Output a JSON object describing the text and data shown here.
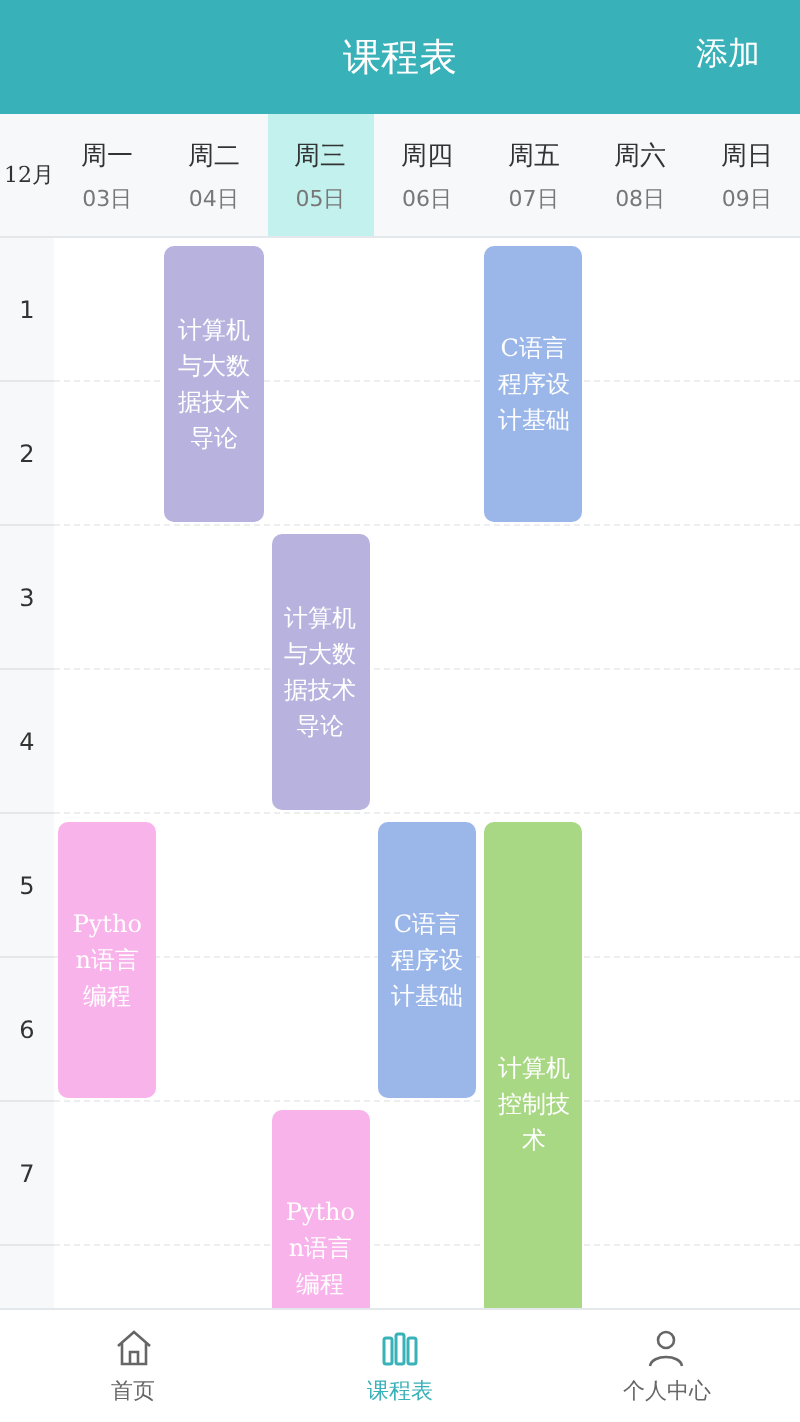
{
  "header": {
    "title": "课程表",
    "action": "添加"
  },
  "month": "12月",
  "days": [
    {
      "name": "周一",
      "date": "03日",
      "selected": false
    },
    {
      "name": "周二",
      "date": "04日",
      "selected": false
    },
    {
      "name": "周三",
      "date": "05日",
      "selected": true
    },
    {
      "name": "周四",
      "date": "06日",
      "selected": false
    },
    {
      "name": "周五",
      "date": "07日",
      "selected": false
    },
    {
      "name": "周六",
      "date": "08日",
      "selected": false
    },
    {
      "name": "周日",
      "date": "09日",
      "selected": false
    }
  ],
  "periods": [
    "1",
    "2",
    "3",
    "4",
    "5",
    "6",
    "7"
  ],
  "columns": [
    {
      "slots": [
        {
          "kind": "empty"
        },
        {
          "kind": "empty"
        },
        {
          "kind": "empty"
        },
        {
          "kind": "empty"
        },
        {
          "kind": "course",
          "title": "Python语言编程",
          "color": "#f8b4ea"
        },
        {
          "kind": "continued"
        },
        {
          "kind": "empty"
        },
        {
          "kind": "empty"
        }
      ]
    },
    {
      "slots": [
        {
          "kind": "course",
          "title": "计算机与大数据技术导论",
          "color": "#b8b2de"
        },
        {
          "kind": "continued"
        },
        {
          "kind": "empty"
        },
        {
          "kind": "empty"
        },
        {
          "kind": "empty"
        },
        {
          "kind": "empty"
        },
        {
          "kind": "empty"
        },
        {
          "kind": "empty"
        }
      ]
    },
    {
      "slots": [
        {
          "kind": "empty"
        },
        {
          "kind": "empty"
        },
        {
          "kind": "course",
          "title": "计算机与大数据技术导论",
          "color": "#b8b2de"
        },
        {
          "kind": "continued"
        },
        {
          "kind": "empty"
        },
        {
          "kind": "empty"
        },
        {
          "kind": "course",
          "title": "Python语言编程",
          "color": "#f8b4ea"
        },
        {
          "kind": "continued"
        }
      ]
    },
    {
      "slots": [
        {
          "kind": "empty"
        },
        {
          "kind": "empty"
        },
        {
          "kind": "empty"
        },
        {
          "kind": "empty"
        },
        {
          "kind": "course",
          "title": "C语言程序设计基础",
          "color": "#9bb6e8"
        },
        {
          "kind": "continued"
        },
        {
          "kind": "empty"
        },
        {
          "kind": "empty"
        }
      ]
    },
    {
      "slots": [
        {
          "kind": "course",
          "title": "C语言程序设计基础",
          "color": "#9bb6e8"
        },
        {
          "kind": "continued"
        },
        {
          "kind": "empty"
        },
        {
          "kind": "empty"
        },
        {
          "kind": "course",
          "title": "计算机控制技术",
          "color": "#a9d884"
        },
        {
          "kind": "continued"
        },
        {
          "kind": "continued"
        },
        {
          "kind": "continued"
        }
      ]
    },
    {
      "slots": [
        {
          "kind": "empty"
        },
        {
          "kind": "empty"
        },
        {
          "kind": "empty"
        },
        {
          "kind": "empty"
        },
        {
          "kind": "empty"
        },
        {
          "kind": "empty"
        },
        {
          "kind": "empty"
        },
        {
          "kind": "empty"
        }
      ]
    },
    {
      "slots": [
        {
          "kind": "empty"
        },
        {
          "kind": "empty"
        },
        {
          "kind": "empty"
        },
        {
          "kind": "empty"
        },
        {
          "kind": "empty"
        },
        {
          "kind": "empty"
        },
        {
          "kind": "empty"
        },
        {
          "kind": "empty"
        }
      ]
    }
  ],
  "nav": [
    {
      "label": "首页",
      "kind": "home",
      "selected": false
    },
    {
      "label": "课程表",
      "kind": "schedule",
      "selected": true
    },
    {
      "label": "个人中心",
      "kind": "profile",
      "selected": false
    }
  ]
}
